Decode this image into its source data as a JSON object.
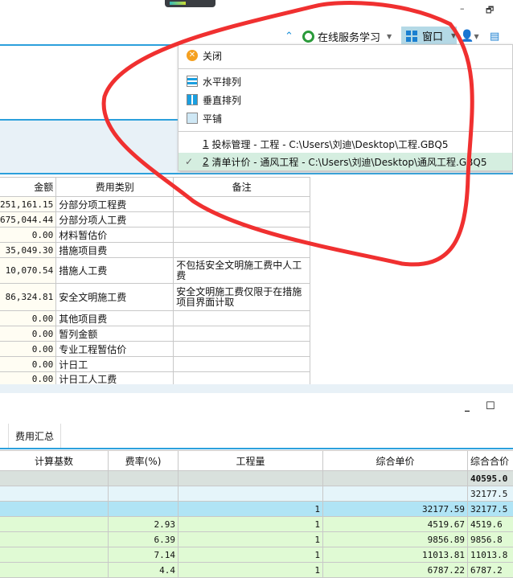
{
  "window": {
    "minimize": "–",
    "restore": "🗗"
  },
  "toolbar": {
    "online_service": "在线服务学习",
    "window_menu": "窗口"
  },
  "menu": {
    "close": "关闭",
    "tile_horizontal": "水平排列",
    "tile_vertical": "垂直排列",
    "tile": "平铺",
    "windows": [
      {
        "num": "1",
        "label": " 投标管理 - 工程 - C:\\Users\\刘迪\\Desktop\\工程.GBQ5",
        "checked": false
      },
      {
        "num": "2",
        "label": " 清单计价 - 通风工程 - C:\\Users\\刘迪\\Desktop\\通风工程.GBQ5",
        "checked": true
      }
    ],
    "check": "✓"
  },
  "upper_table": {
    "headers": [
      "金额",
      "费用类别",
      "备注"
    ],
    "rows": [
      [
        "251,161.15",
        "分部分项工程费",
        ""
      ],
      [
        "675,044.44",
        "分部分项人工费",
        ""
      ],
      [
        "0.00",
        "材料暂估价",
        ""
      ],
      [
        "35,049.30",
        "措施项目费",
        ""
      ],
      [
        "10,070.54",
        "措施人工费",
        "不包括安全文明施工费中人工费"
      ],
      [
        "86,324.81",
        "安全文明施工费",
        "安全文明施工费仅限于在措施项目界面计取"
      ],
      [
        "0.00",
        "其他项目费",
        ""
      ],
      [
        "0.00",
        "暂列金额",
        ""
      ],
      [
        "0.00",
        "专业工程暂估价",
        ""
      ],
      [
        "0.00",
        "计日工",
        ""
      ],
      [
        "0.00",
        "计日工人工费",
        ""
      ]
    ]
  },
  "lower_panel": {
    "tab": "费用汇总",
    "minimize": "_",
    "maximize": "☐",
    "headers": [
      "计算基数",
      "费率(%)",
      "工程量",
      "综合单价",
      "综合合价"
    ],
    "rows": [
      [
        "",
        "",
        "",
        "",
        "40595.0"
      ],
      [
        "",
        "",
        "",
        "",
        "32177.5"
      ],
      [
        "",
        "",
        "1",
        "32177.59",
        "32177.5"
      ],
      [
        "",
        "2.93",
        "1",
        "4519.67",
        "4519.6"
      ],
      [
        "",
        "6.39",
        "1",
        "9856.89",
        "9856.8"
      ],
      [
        "",
        "7.14",
        "1",
        "11013.81",
        "11013.8"
      ],
      [
        "",
        "4.4",
        "1",
        "6787.22",
        "6787.2"
      ]
    ]
  },
  "colors": {
    "accent": "#2ca0dc",
    "annotation": "#f03030",
    "row_total": "#d9e1dd",
    "row_light": "#e5f5fa",
    "row_selected": "#b0e4f5",
    "row_green": "#e0fad4"
  }
}
